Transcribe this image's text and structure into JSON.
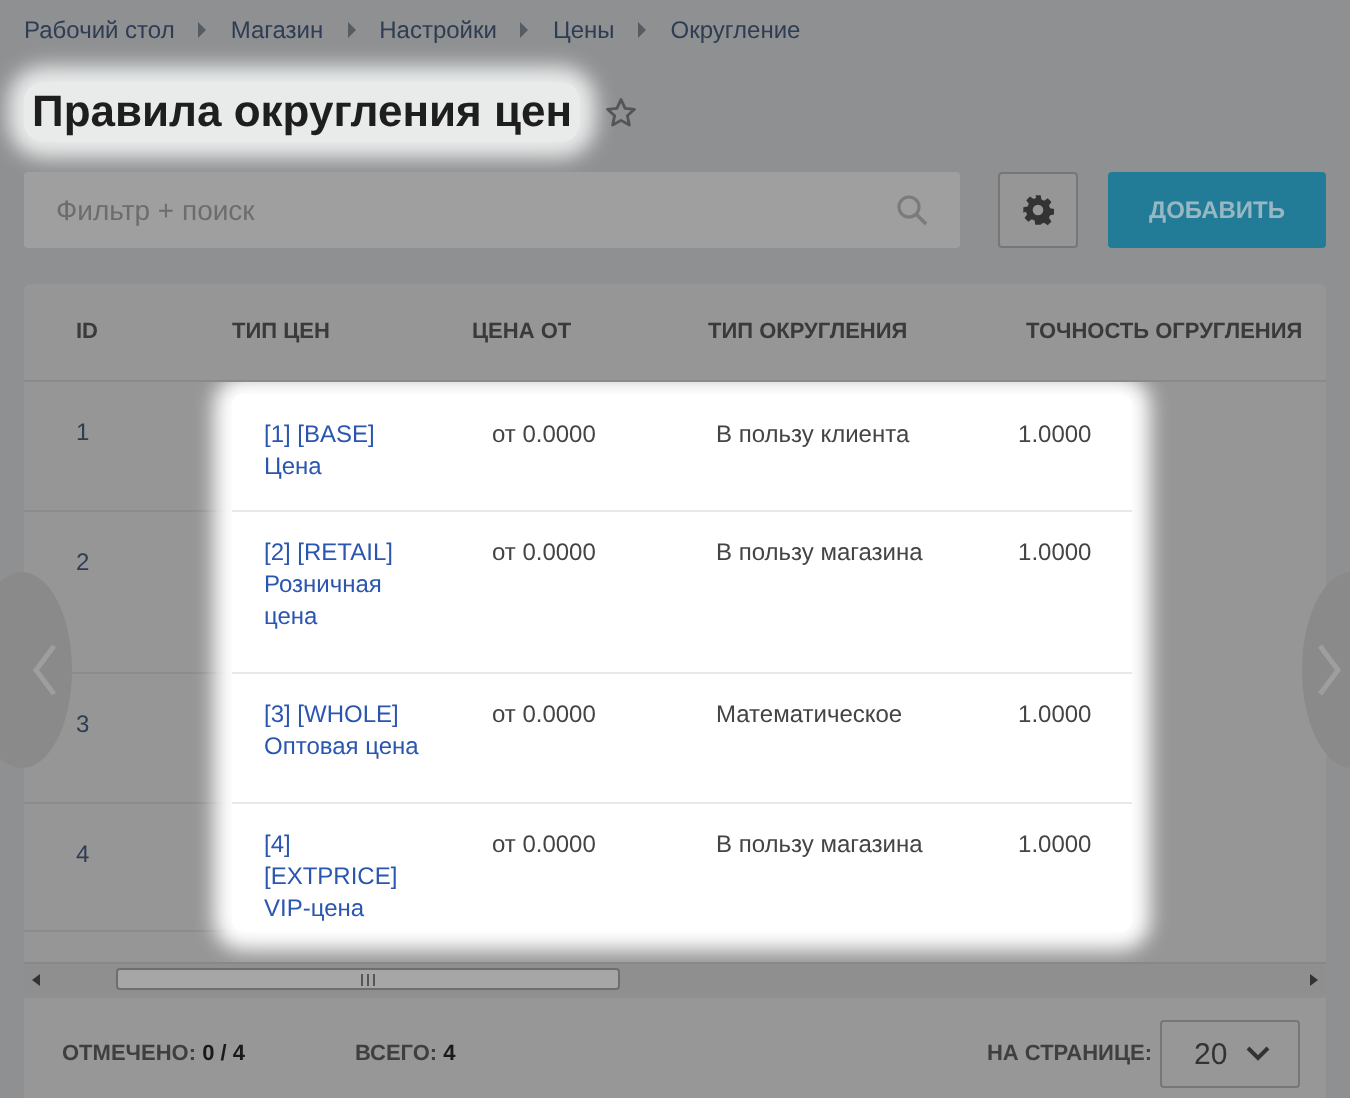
{
  "breadcrumbs": [
    "Рабочий стол",
    "Магазин",
    "Настройки",
    "Цены",
    "Округление"
  ],
  "title": "Правила округления цен",
  "favorite": {
    "selected": false
  },
  "search": {
    "placeholder": "Фильтр + поиск"
  },
  "add_button": "ДОБАВИТЬ",
  "table": {
    "columns": [
      "ID",
      "ТИП ЦЕН",
      "ЦЕНА ОТ",
      "ТИП ОКРУГЛЕНИЯ",
      "ТОЧНОСТЬ ОГРУГЛЕНИЯ"
    ],
    "rows": [
      {
        "id": "1",
        "price_type": [
          "[1] [BASE]",
          "Цена"
        ],
        "price_from": "от 0.0000",
        "rounding_type": "В пользу клиента",
        "precision": "1.0000"
      },
      {
        "id": "2",
        "price_type": [
          "[2] [RETAIL]",
          "Розничная",
          "цена"
        ],
        "price_from": "от 0.0000",
        "rounding_type": "В пользу магазина",
        "precision": "1.0000"
      },
      {
        "id": "3",
        "price_type": [
          "[3] [WHOLE]",
          "Оптовая цена"
        ],
        "price_from": "от 0.0000",
        "rounding_type": "Математическое",
        "precision": "1.0000"
      },
      {
        "id": "4",
        "price_type": [
          "[4]",
          "[EXTPRICE]",
          "VIP-цена"
        ],
        "price_from": "от 0.0000",
        "rounding_type": "В пользу магазина",
        "precision": "1.0000"
      }
    ]
  },
  "footer": {
    "selected_label": "ОТМЕЧЕНО: **0 / 4**",
    "total_label": "ВСЕГО: **4**",
    "per_page_label": "НА СТРАНИЦЕ:",
    "per_page_value": "20"
  }
}
